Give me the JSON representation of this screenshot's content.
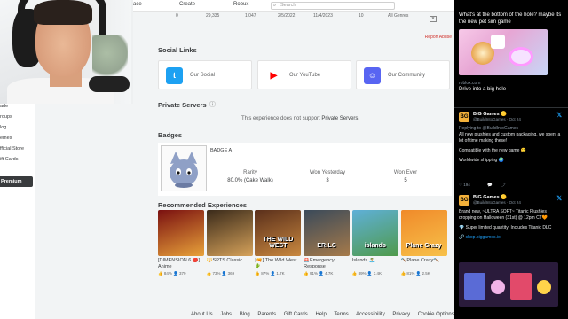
{
  "topnav": {
    "links": [
      "ace",
      "Create",
      "Robux"
    ],
    "search_placeholder": "Search"
  },
  "sidebar": {
    "items": [
      "ade",
      "roups",
      "log",
      "emes",
      "fficial Store",
      "ift Cards"
    ],
    "premium_label": "Premium"
  },
  "stats": {
    "values": [
      "0",
      "29,335",
      "1,047",
      "2/5/2022",
      "11/4/2023",
      "10",
      "All Genres"
    ]
  },
  "report_abuse": "Report Abuse",
  "social": {
    "title": "Social Links",
    "links": [
      {
        "label": "Our Social",
        "icon": "twitter-icon",
        "color": "#1da1f2"
      },
      {
        "label": "Our YouTube",
        "icon": "youtube-icon",
        "color": "#ff0000"
      },
      {
        "label": "Our Community",
        "icon": "discord-icon",
        "color": "#5865f2"
      }
    ]
  },
  "private_servers": {
    "title": "Private Servers",
    "message_prefix": "This experience does not support",
    "message_emph": "Private Servers."
  },
  "badges": {
    "title": "Badges",
    "name": "BADGE A",
    "columns": [
      {
        "label": "Rarity",
        "value": "80.0% (Cake Walk)"
      },
      {
        "label": "Won Yesterday",
        "value": "3"
      },
      {
        "label": "Won Ever",
        "value": "5"
      }
    ]
  },
  "recommended": {
    "title": "Recommended Experiences",
    "items": [
      {
        "title": "[DIMENSION 6 🔴] Anime",
        "likes": "84%",
        "players": "379",
        "thumb_text": "",
        "c1": "#7a1010",
        "c2": "#e8a23a"
      },
      {
        "title": "🔱SPTS Classic",
        "likes": "73%",
        "players": "369",
        "thumb_text": "",
        "c1": "#3a2a1a",
        "c2": "#d6a25a"
      },
      {
        "title": "[🔫] The Wild West 🌵",
        "likes": "87%",
        "players": "1.7K",
        "thumb_text": "THE WILD WEST",
        "c1": "#5a2f1b",
        "c2": "#c9883f"
      },
      {
        "title": "🚨Emergency Response",
        "likes": "91%",
        "players": "4.7K",
        "thumb_text": "ER:LC",
        "c1": "#3a4a5a",
        "c2": "#a67a4a"
      },
      {
        "title": "Islands 🏝️",
        "likes": "89%",
        "players": "3.4K",
        "thumb_text": "islands",
        "c1": "#5fb0d8",
        "c2": "#4f9a4a"
      },
      {
        "title": "🔨Plane Crazy🔨",
        "likes": "81%",
        "players": "2.5K",
        "thumb_text": "Plane Crazy",
        "c1": "#f08a2a",
        "c2": "#f7c14a"
      }
    ]
  },
  "footer": {
    "links": [
      "About Us",
      "Jobs",
      "Blog",
      "Parents",
      "Gift Cards",
      "Help",
      "Terms",
      "Accessibility",
      "Privacy",
      "Cookie Options"
    ]
  },
  "twitter": {
    "ad_text": "What's at the bottom of the hole? maybe its the new pet sim game",
    "ad_url": "roblox.com",
    "ad_cta": "Drive into a big hole",
    "tweets": [
      {
        "name": "BIG Games 🟡",
        "handle": "@BuildIntoGames · Oct 24",
        "reply": "Replying to @BuildIntoGames",
        "text": "All new plushies and custom packaging, we spent a lot of time making these!",
        "text2": "Compatible with the new game 😊",
        "text3": "Worldwide shipping 🌍",
        "likes": "194",
        "replies": ""
      },
      {
        "name": "BIG Games 🟡",
        "handle": "@BuildIntoGames · Oct 24",
        "text": "Brand new, ~ULTRA SOFT~ Titanic Plushies dropping on Halloween (31st) @ 12pm CT🧡",
        "text2": "💎 Super limited quantity! Includes Titanic DLC",
        "link": "🔗 shop.biggames.io"
      }
    ]
  },
  "colors": {
    "accent": "#393b3d",
    "link_red": "#d0302a",
    "twitter_blue": "#1d9bf0"
  }
}
